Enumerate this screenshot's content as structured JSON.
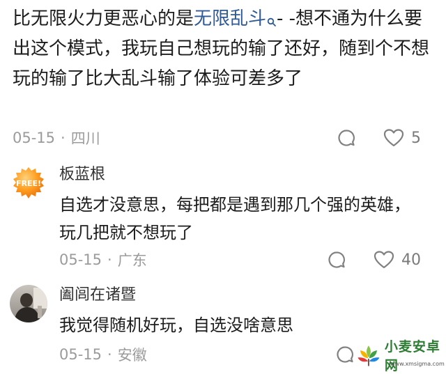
{
  "main_comment": {
    "text_before": "比无限火力更恶心的是",
    "topic_link": "无限乱斗",
    "text_after": "- -想不通为什么要出这个模式，我玩自己想玩的输了还好，随到个不想玩的输了比大乱斗输了体验可差多了",
    "date": "05-15",
    "location": "四川",
    "likes": "5"
  },
  "replies": [
    {
      "username": "板蓝根",
      "avatar_badge": "FREE!",
      "text": "自选才没意思，每把都是遇到那几个强的英雄，玩几把就不想玩了",
      "date": "05-15",
      "location": "广东",
      "likes": "40"
    },
    {
      "username": "阖闾在诸暨",
      "text": "我觉得随机好玩，自选没啥意思",
      "date": "05-15",
      "location": "安徽"
    }
  ],
  "separator": "·",
  "icons": {
    "reply": "reply-bubble-icon",
    "like": "heart-outline-icon",
    "topic": "search-icon"
  },
  "colors": {
    "link": "#2f5a96",
    "meta": "#9b9b9b",
    "text": "#1c1c1c"
  },
  "watermark": {
    "text": "小麦安卓网",
    "sub": "www.xmsigma.com"
  }
}
